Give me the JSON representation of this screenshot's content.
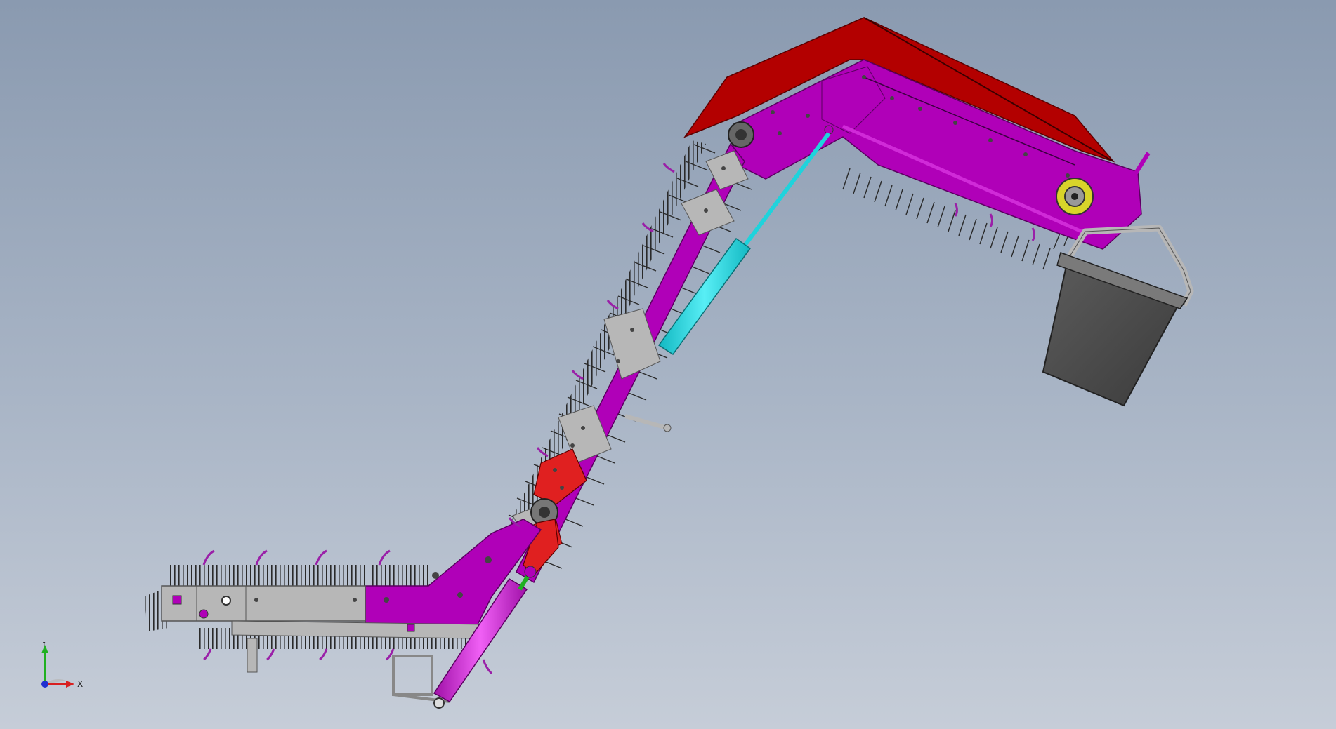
{
  "viewport": {
    "background_top": "#8a9ab0",
    "background_bottom": "#c6cdd8"
  },
  "model": {
    "colors": {
      "hood": "#b30000",
      "frame": "#b000b8",
      "bracket": "#b7b7b7",
      "cylinder": "#1fd3dc",
      "pusher_rod": "#d02ad8",
      "bucket": "#4a4a4a",
      "bearing": "#d8d42a",
      "bristle": "#2a2a2a",
      "hook": "#9a20a8"
    },
    "icons": {
      "lower_bearing": "bearing-icon",
      "mid_bearing": "bearing-icon",
      "drive_bearing": "bearing-icon"
    }
  },
  "triad": {
    "x_label": "X",
    "y_label": "Y",
    "x_color": "#d82020",
    "y_color": "#20b020",
    "z_color": "#2030d0"
  }
}
